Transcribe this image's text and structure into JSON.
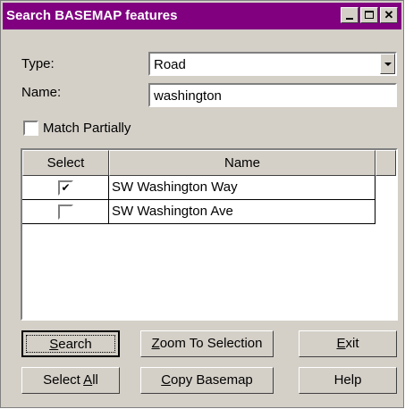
{
  "window": {
    "title": "Search BASEMAP features"
  },
  "form": {
    "type_label": "Type:",
    "type_value": "Road",
    "name_label": "Name:",
    "name_value": "washington",
    "match_partially_label": "Match Partially",
    "match_partially_checked": false
  },
  "grid": {
    "columns": [
      "Select",
      "Name"
    ],
    "rows": [
      {
        "selected": true,
        "name": "SW Washington Way"
      },
      {
        "selected": false,
        "name": "SW Washington Ave"
      }
    ]
  },
  "buttons": {
    "search": {
      "access": "S",
      "rest": "earch"
    },
    "zoom": {
      "access": "Z",
      "rest": "oom To Selection"
    },
    "exit": {
      "access": "E",
      "rest": "xit"
    },
    "select_all": {
      "pre": "Select ",
      "access": "A",
      "rest": "ll"
    },
    "copy_basemap": {
      "access": "C",
      "rest": "opy Basemap"
    },
    "help": "Help"
  },
  "glyphs": {
    "check": "✔",
    "close": "✕"
  }
}
